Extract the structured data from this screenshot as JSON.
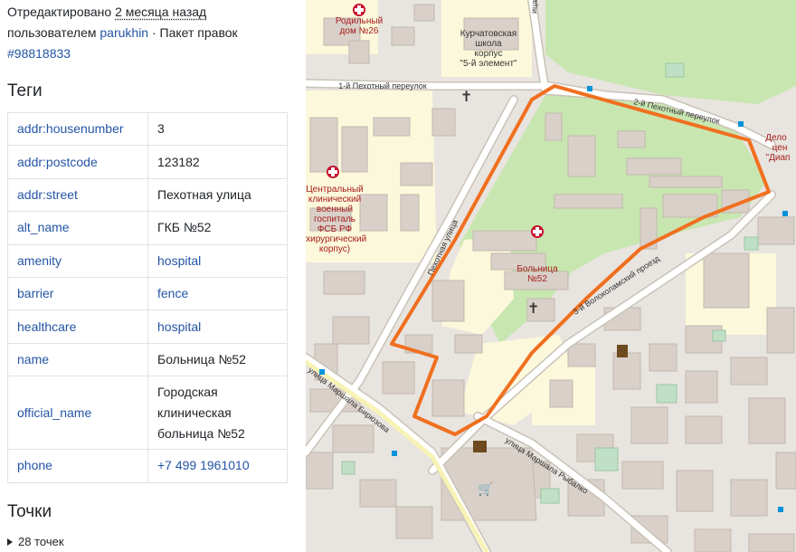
{
  "sidebar": {
    "edited_prefix": "Отредактировано",
    "edited_ago": "2 месяца назад",
    "by_prefix": "пользователем",
    "user": "parukhin",
    "separator": "·",
    "changeset_prefix": "Пакет правок",
    "changeset_id": "#98818833",
    "tags_heading": "Теги",
    "tags": [
      {
        "key": "addr:housenumber",
        "value": "3",
        "link": false
      },
      {
        "key": "addr:postcode",
        "value": "123182",
        "link": false
      },
      {
        "key": "addr:street",
        "value": "Пехотная улица",
        "link": false
      },
      {
        "key": "alt_name",
        "value": "ГКБ №52",
        "link": false
      },
      {
        "key": "amenity",
        "value": "hospital",
        "link": true
      },
      {
        "key": "barrier",
        "value": "fence",
        "link": true
      },
      {
        "key": "healthcare",
        "value": "hospital",
        "link": true
      },
      {
        "key": "name",
        "value": "Больница №52",
        "link": false
      },
      {
        "key": "official_name",
        "value": "Городская клиническая больница №52",
        "link": false
      },
      {
        "key": "phone",
        "value": "+7 499 1961010",
        "link": true
      }
    ],
    "nodes_heading": "Точки",
    "nodes_count": "28 точек"
  },
  "map": {
    "colors": {
      "background": "#e8e4df",
      "park": "#c8e6b0",
      "building": "#d9d0c9",
      "hospital_area": "#fcf8db",
      "road": "#ffffff",
      "road_outline": "#c9c2b8",
      "highlight": "#f06f1f",
      "hospital_red": "#c8102e",
      "label": "#333333",
      "label_red": "#a61b1b"
    },
    "labels": {
      "maternity": [
        "Родильный",
        "дом №26"
      ],
      "school": [
        "Курчатовская",
        "школа",
        "корпус",
        "\"5-й элемент\""
      ],
      "lane1": "1-й Пехотный переулок",
      "lane2": "2-й Пехотный переулок",
      "street_pekhotnaya": "Пехотная улица",
      "mil_hospital": [
        "Центральный",
        "клинический",
        "военный",
        "госпиталь",
        "ФСБ РФ",
        "(хирургический",
        "корпус)"
      ],
      "hospital": [
        "Больница",
        "№52"
      ],
      "volokolamsky": "3-й Волоколамский проезд",
      "biryuzova": "улица Маршала Бирюзова",
      "rybalko": "улица Маршала Рыбалко",
      "right_edge_1": "ица",
      "right_edge_2": [
        "Дело",
        "цен",
        "\"Диап"
      ],
      "right_edge_3": "Дело"
    }
  }
}
